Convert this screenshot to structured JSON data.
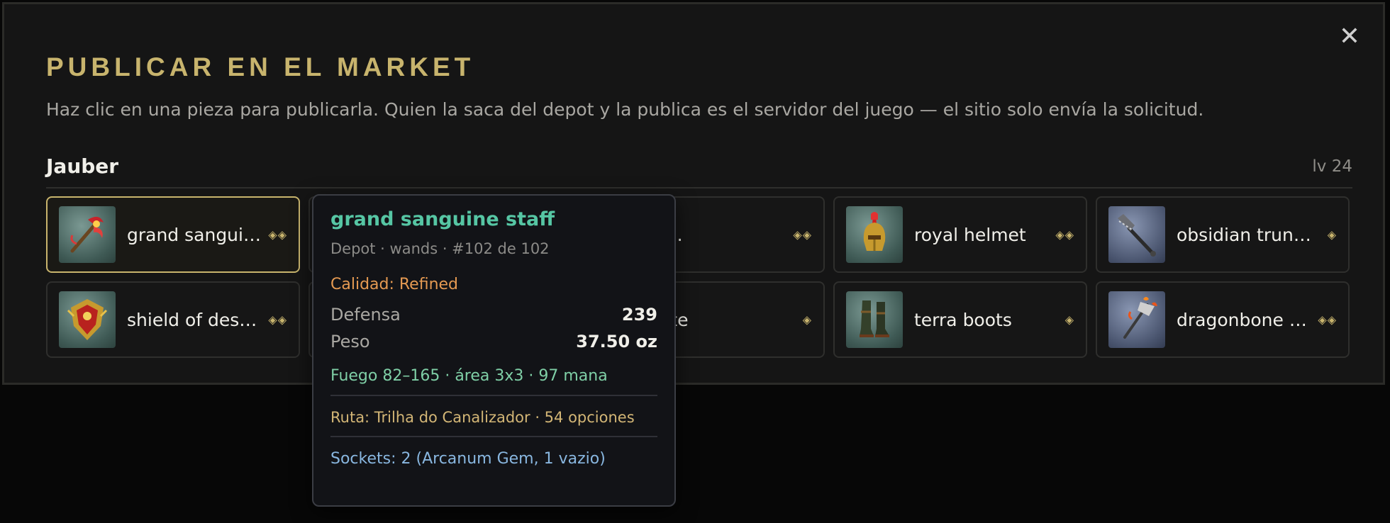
{
  "modal": {
    "title": "PUBLICAR EN EL MARKET",
    "subtitle": "Haz clic en una pieza para publicarla. Quien la saca del depot y la publica es el servidor del juego — el sitio solo envía la solicitud.",
    "close_label": "✕",
    "character": {
      "name": "Jauber",
      "level": "lv 24"
    }
  },
  "items": [
    {
      "name": "grand sanguine staff",
      "rarity": "◈◈",
      "icon": "staff-icon",
      "bg": "green",
      "selected": true
    },
    {
      "name": "",
      "rarity": "",
      "icon": "",
      "bg": "green",
      "selected": false
    },
    {
      "name": "magic plate armor",
      "display": "gic plate ...",
      "rarity": "◈◈",
      "icon": "armor-icon",
      "bg": "green",
      "selected": false
    },
    {
      "name": "royal helmet",
      "rarity": "◈◈",
      "icon": "helmet-icon",
      "bg": "green",
      "selected": false
    },
    {
      "name": "obsidian truncheon",
      "rarity": "◈",
      "icon": "mace-icon",
      "bg": "blue",
      "selected": false
    },
    {
      "name": "shield of destiny",
      "rarity": "◈◈",
      "icon": "shield-icon",
      "bg": "green",
      "selected": false
    },
    {
      "name": "",
      "rarity": "",
      "icon": "",
      "bg": "green",
      "selected": false
    },
    {
      "name": "boots of haste",
      "display": "ots of haste",
      "rarity": "◈",
      "icon": "boots-icon",
      "bg": "green",
      "selected": false
    },
    {
      "name": "terra boots",
      "rarity": "◈",
      "icon": "boots-icon",
      "bg": "green",
      "selected": false
    },
    {
      "name": "dragonbone staff",
      "rarity": "◈◈",
      "icon": "axe-icon",
      "bg": "blue",
      "selected": false
    }
  ],
  "tooltip": {
    "name": "grand sanguine staff",
    "meta": "Depot · wands · #102 de 102",
    "quality": "Calidad: Refined",
    "stats": [
      {
        "label": "Defensa",
        "value": "239"
      },
      {
        "label": "Peso",
        "value": "37.50 oz"
      }
    ],
    "effect": "Fuego 82–165 · área 3x3 · 97 mana",
    "route": "Ruta: Trilha do Canalizador · 54 opciones",
    "sockets": "Sockets: 2 (Arcanum Gem, 1 vazio)"
  },
  "colors": {
    "accent_gold": "#c8b46d",
    "tooltip_name": "#56c6a4",
    "quality": "#e59a52",
    "effect": "#7fcfa6",
    "sockets": "#89b7e0"
  }
}
